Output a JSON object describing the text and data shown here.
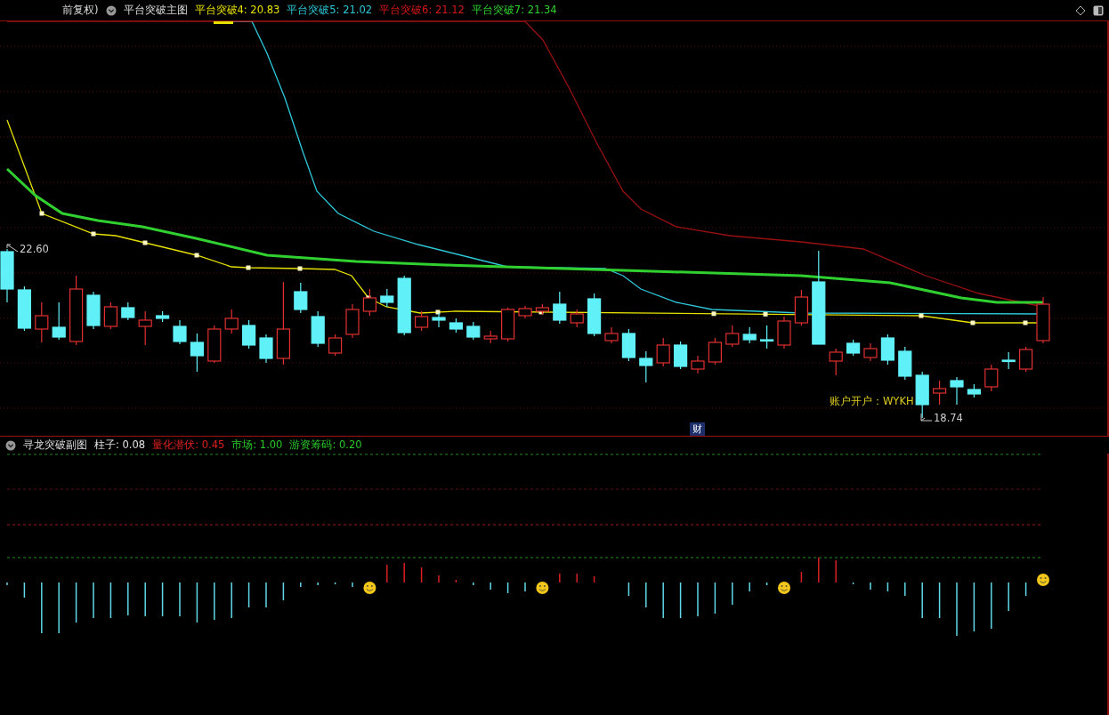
{
  "main_panel": {
    "adjust_label": "前复权)",
    "title": "平台突破主图",
    "indicators": [
      {
        "text": "平台突破4: 20.83",
        "color": "#e6e000"
      },
      {
        "text": "平台突破5: 21.02",
        "color": "#2ec8d8"
      },
      {
        "text": "平台突破6: 21.12",
        "color": "#d81818"
      },
      {
        "text": "平台突破7: 21.34",
        "color": "#30d030"
      }
    ],
    "price_high": "22.60",
    "price_low": "18.74",
    "note": "账户开户：WYKH",
    "marker": "财"
  },
  "sub_panel": {
    "title": "寻龙突破副图",
    "indicators": [
      {
        "text": "柱子: 0.08",
        "color": "#e0e0e0"
      },
      {
        "text": "量化潜伏: 0.45",
        "color": "#e02020"
      },
      {
        "text": "市场: 1.00",
        "color": "#28c828"
      },
      {
        "text": "游资筹码: 0.20",
        "color": "#28c828"
      }
    ]
  }
}
